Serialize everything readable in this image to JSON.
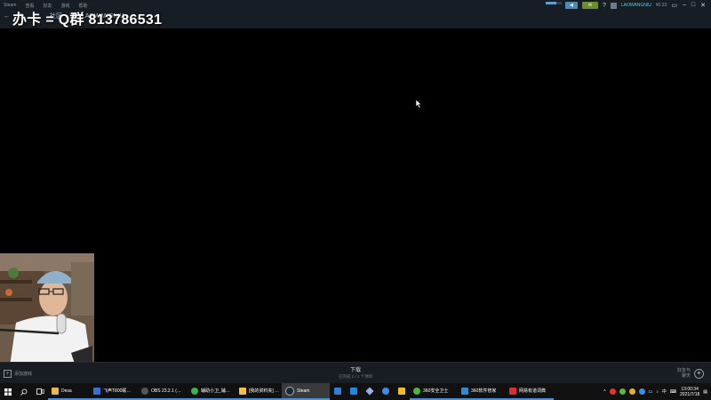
{
  "steam": {
    "menu": [
      "Steam",
      "查看",
      "好友",
      "游戏",
      "帮助"
    ],
    "nav": {
      "back": "←",
      "tab1": "库",
      "tab2": "社区",
      "breadcrumb": "LAOWANGNIU"
    },
    "overlay_text": "办卡 = Q群 813786531",
    "top_right": {
      "username": "LAOWANGNIU",
      "balance": "¥0.33",
      "help": "?"
    },
    "bottom": {
      "add_game": "添加游戏",
      "download_label": "下载",
      "download_sub": "已完成 1 / 1 个项目",
      "friends_line1": "好友与",
      "friends_line2": "聊天"
    }
  },
  "taskbar": {
    "apps": [
      {
        "label": "Desa",
        "color": "#e8b94a"
      },
      {
        "label": "飞声T800联…",
        "color": "#3a6fd8"
      },
      {
        "label": "OBS 23.2.1 (…",
        "color": "#555555"
      },
      {
        "label": "辅助小卫_辅…",
        "color": "#38b24a"
      },
      {
        "label": "[我的资料夹] …",
        "color": "#f0c040"
      },
      {
        "label": "Steam",
        "color": "#1b2838"
      },
      {
        "label": "360安全卫士",
        "color": "#4cb83a"
      },
      {
        "label": "360软件管家",
        "color": "#2f8ad8"
      },
      {
        "label": "网易有道词典",
        "color": "#d83030"
      }
    ],
    "tray": {
      "ime": "中",
      "time": "13:00:34",
      "date": "2021/7/18"
    }
  }
}
